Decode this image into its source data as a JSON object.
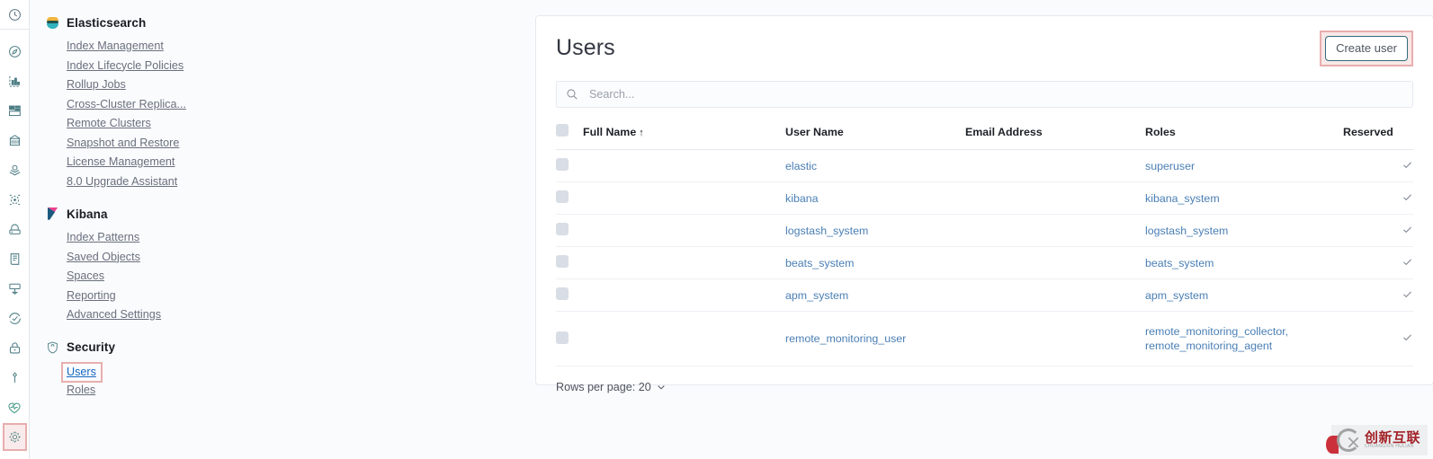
{
  "rail": {
    "items": [
      {
        "name": "recent-icon",
        "icon": "clock"
      },
      {
        "name": "discover-icon",
        "icon": "compass"
      },
      {
        "name": "visualize-icon",
        "icon": "chart"
      },
      {
        "name": "dashboard-icon",
        "icon": "dashboard"
      },
      {
        "name": "canvas-icon",
        "icon": "canvas"
      },
      {
        "name": "maps-icon",
        "icon": "map-marker"
      },
      {
        "name": "machine-learning-icon",
        "icon": "ml"
      },
      {
        "name": "infrastructure-icon",
        "icon": "infra"
      },
      {
        "name": "logs-icon",
        "icon": "logs"
      },
      {
        "name": "apm-icon",
        "icon": "apm"
      },
      {
        "name": "uptime-icon",
        "icon": "uptime"
      },
      {
        "name": "siem-icon",
        "icon": "lock"
      },
      {
        "name": "dev-tools-icon",
        "icon": "wrench"
      },
      {
        "name": "monitoring-icon",
        "icon": "heartbeat"
      },
      {
        "name": "management-icon",
        "icon": "gear",
        "highlighted": true
      }
    ]
  },
  "nav": {
    "groups": [
      {
        "title": "Elasticsearch",
        "icon": "elasticsearch-logo",
        "items": [
          {
            "label": "Index Management"
          },
          {
            "label": "Index Lifecycle Policies"
          },
          {
            "label": "Rollup Jobs"
          },
          {
            "label": "Cross-Cluster Replica..."
          },
          {
            "label": "Remote Clusters"
          },
          {
            "label": "Snapshot and Restore"
          },
          {
            "label": "License Management"
          },
          {
            "label": "8.0 Upgrade Assistant"
          }
        ]
      },
      {
        "title": "Kibana",
        "icon": "kibana-logo",
        "items": [
          {
            "label": "Index Patterns"
          },
          {
            "label": "Saved Objects"
          },
          {
            "label": "Spaces"
          },
          {
            "label": "Reporting"
          },
          {
            "label": "Advanced Settings"
          }
        ]
      },
      {
        "title": "Security",
        "icon": "security-shield-icon",
        "items": [
          {
            "label": "Users",
            "active": true,
            "highlighted": true
          },
          {
            "label": "Roles"
          }
        ]
      }
    ]
  },
  "page": {
    "title": "Users",
    "create_button": "Create user",
    "search_placeholder": "Search...",
    "search_value": "",
    "rows_per_page_label": "Rows per page: 20"
  },
  "table": {
    "columns": [
      {
        "key": "full_name",
        "label": "Full Name",
        "sorted": "asc",
        "sort_glyph": "↑"
      },
      {
        "key": "user_name",
        "label": "User Name"
      },
      {
        "key": "email",
        "label": "Email Address"
      },
      {
        "key": "roles",
        "label": "Roles"
      },
      {
        "key": "reserved",
        "label": "Reserved"
      }
    ],
    "rows": [
      {
        "full_name": "",
        "user_name": "elastic",
        "email": "",
        "roles": "superuser",
        "reserved": true
      },
      {
        "full_name": "",
        "user_name": "kibana",
        "email": "",
        "roles": "kibana_system",
        "reserved": true
      },
      {
        "full_name": "",
        "user_name": "logstash_system",
        "email": "",
        "roles": "logstash_system",
        "reserved": true
      },
      {
        "full_name": "",
        "user_name": "beats_system",
        "email": "",
        "roles": "beats_system",
        "reserved": true
      },
      {
        "full_name": "",
        "user_name": "apm_system",
        "email": "",
        "roles": "apm_system",
        "reserved": true
      },
      {
        "full_name": "",
        "user_name": "remote_monitoring_user",
        "email": "",
        "roles": "remote_monitoring_collector, remote_monitoring_agent",
        "reserved": true,
        "tall": true
      }
    ]
  },
  "watermark": {
    "cn": "创新互联",
    "en": "CHUANGXIN HULIAN"
  },
  "colors": {
    "link": "#4a7fb5",
    "highlight_border": "#e8aeae",
    "button_border": "#326b7a",
    "active_link": "#1668c1"
  }
}
